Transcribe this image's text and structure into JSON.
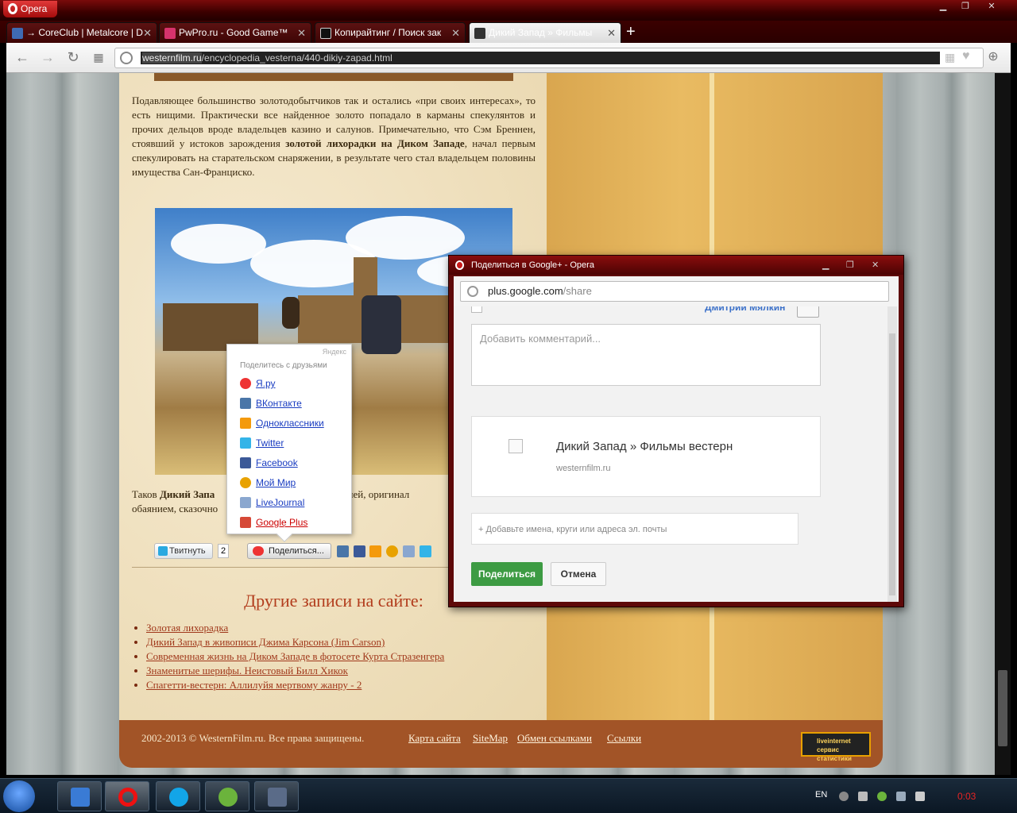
{
  "browser": {
    "menu_label": "Opera",
    "tabs": [
      {
        "label": "→ CoreClub | Metalcore | D"
      },
      {
        "label": "PwPro.ru - Good Game™"
      },
      {
        "label": "Копирайтинг / Поиск зак"
      },
      {
        "label": "Дикий Запад » Фильмы"
      }
    ],
    "url": {
      "domain": "westernfilm.ru",
      "path": "/encyclopedia_vesterna/440-dikiy-zapad.html"
    }
  },
  "article": {
    "p1_a": "Подавляющее большинство золотодобытчиков так и остались «при своих интересах», то есть нищими. Практически все найденное золото попадало в карманы спекулянтов и прочих дельцов вроде владельцев казино и салунов. Примечательно, что Сэм Бреннен, стоявший у истоков зарождения ",
    "p1_bold": "золотой лихорадки на Диком Западе",
    "p1_b": ", начал первым спекулировать на старательском снаряжении, в результате чего стал владельцем половины имущества Сан-Франциско.",
    "caption_a": "Таков ",
    "caption_bold": "Дикий Запа",
    "caption_b": "историей, оригинал",
    "caption_c": "обаянием, сказочно"
  },
  "sharebar": {
    "tweet_label": "Твитнуть",
    "tweet_count": "2",
    "share_label": "Поделиться..."
  },
  "ya_popup": {
    "brand": "Яндекс",
    "header": "Поделитесь с друзьями",
    "items": [
      {
        "label": "Я.ру"
      },
      {
        "label": "ВКонтакте"
      },
      {
        "label": "Одноклассники"
      },
      {
        "label": "Twitter"
      },
      {
        "label": "Facebook"
      },
      {
        "label": "Мой Мир"
      },
      {
        "label": "LiveJournal"
      },
      {
        "label": "Google Plus"
      }
    ]
  },
  "other_posts": {
    "title": "Другие записи на сайте:",
    "items": [
      "Золотая лихорадка",
      "Дикий Запад в живописи Джима Карсона (Jim Carson)",
      "Современная жизнь на Диком Западе в фотосете Курта Стразенгера",
      "Знаменитые шерифы. Неистовый Билл Хикок",
      "Спагетти-вестерн: Аллилуйя мертвому жанру - 2"
    ]
  },
  "footer": {
    "copyright": "2002-2013 © WesternFilm.ru. Все права защищены.",
    "links": [
      "Карта сайта",
      "SiteMap",
      "Обмен ссылками",
      "Ссылки"
    ],
    "counter_line1": "liveinternet",
    "counter_line2": "сервис статистики"
  },
  "gplus": {
    "window_title": "Поделиться в Google+ - Opera",
    "url_host": "plus.google.com",
    "url_path": "/share",
    "user_name": "Дмитрий Мялкин",
    "comment_placeholder": "Добавить комментарий...",
    "card_title": "Дикий Запад » Фильмы вестерн",
    "card_domain": "westernfilm.ru",
    "people_placeholder": "+ Добавьте имена, круги или адреса эл. почты",
    "share_label": "Поделиться",
    "cancel_label": "Отмена"
  },
  "taskbar": {
    "lang": "EN",
    "clock": "0:03"
  },
  "colors": {
    "accent_red": "#cc0000",
    "share_green": "#3d9b43",
    "link_blue": "#3c71c9"
  }
}
